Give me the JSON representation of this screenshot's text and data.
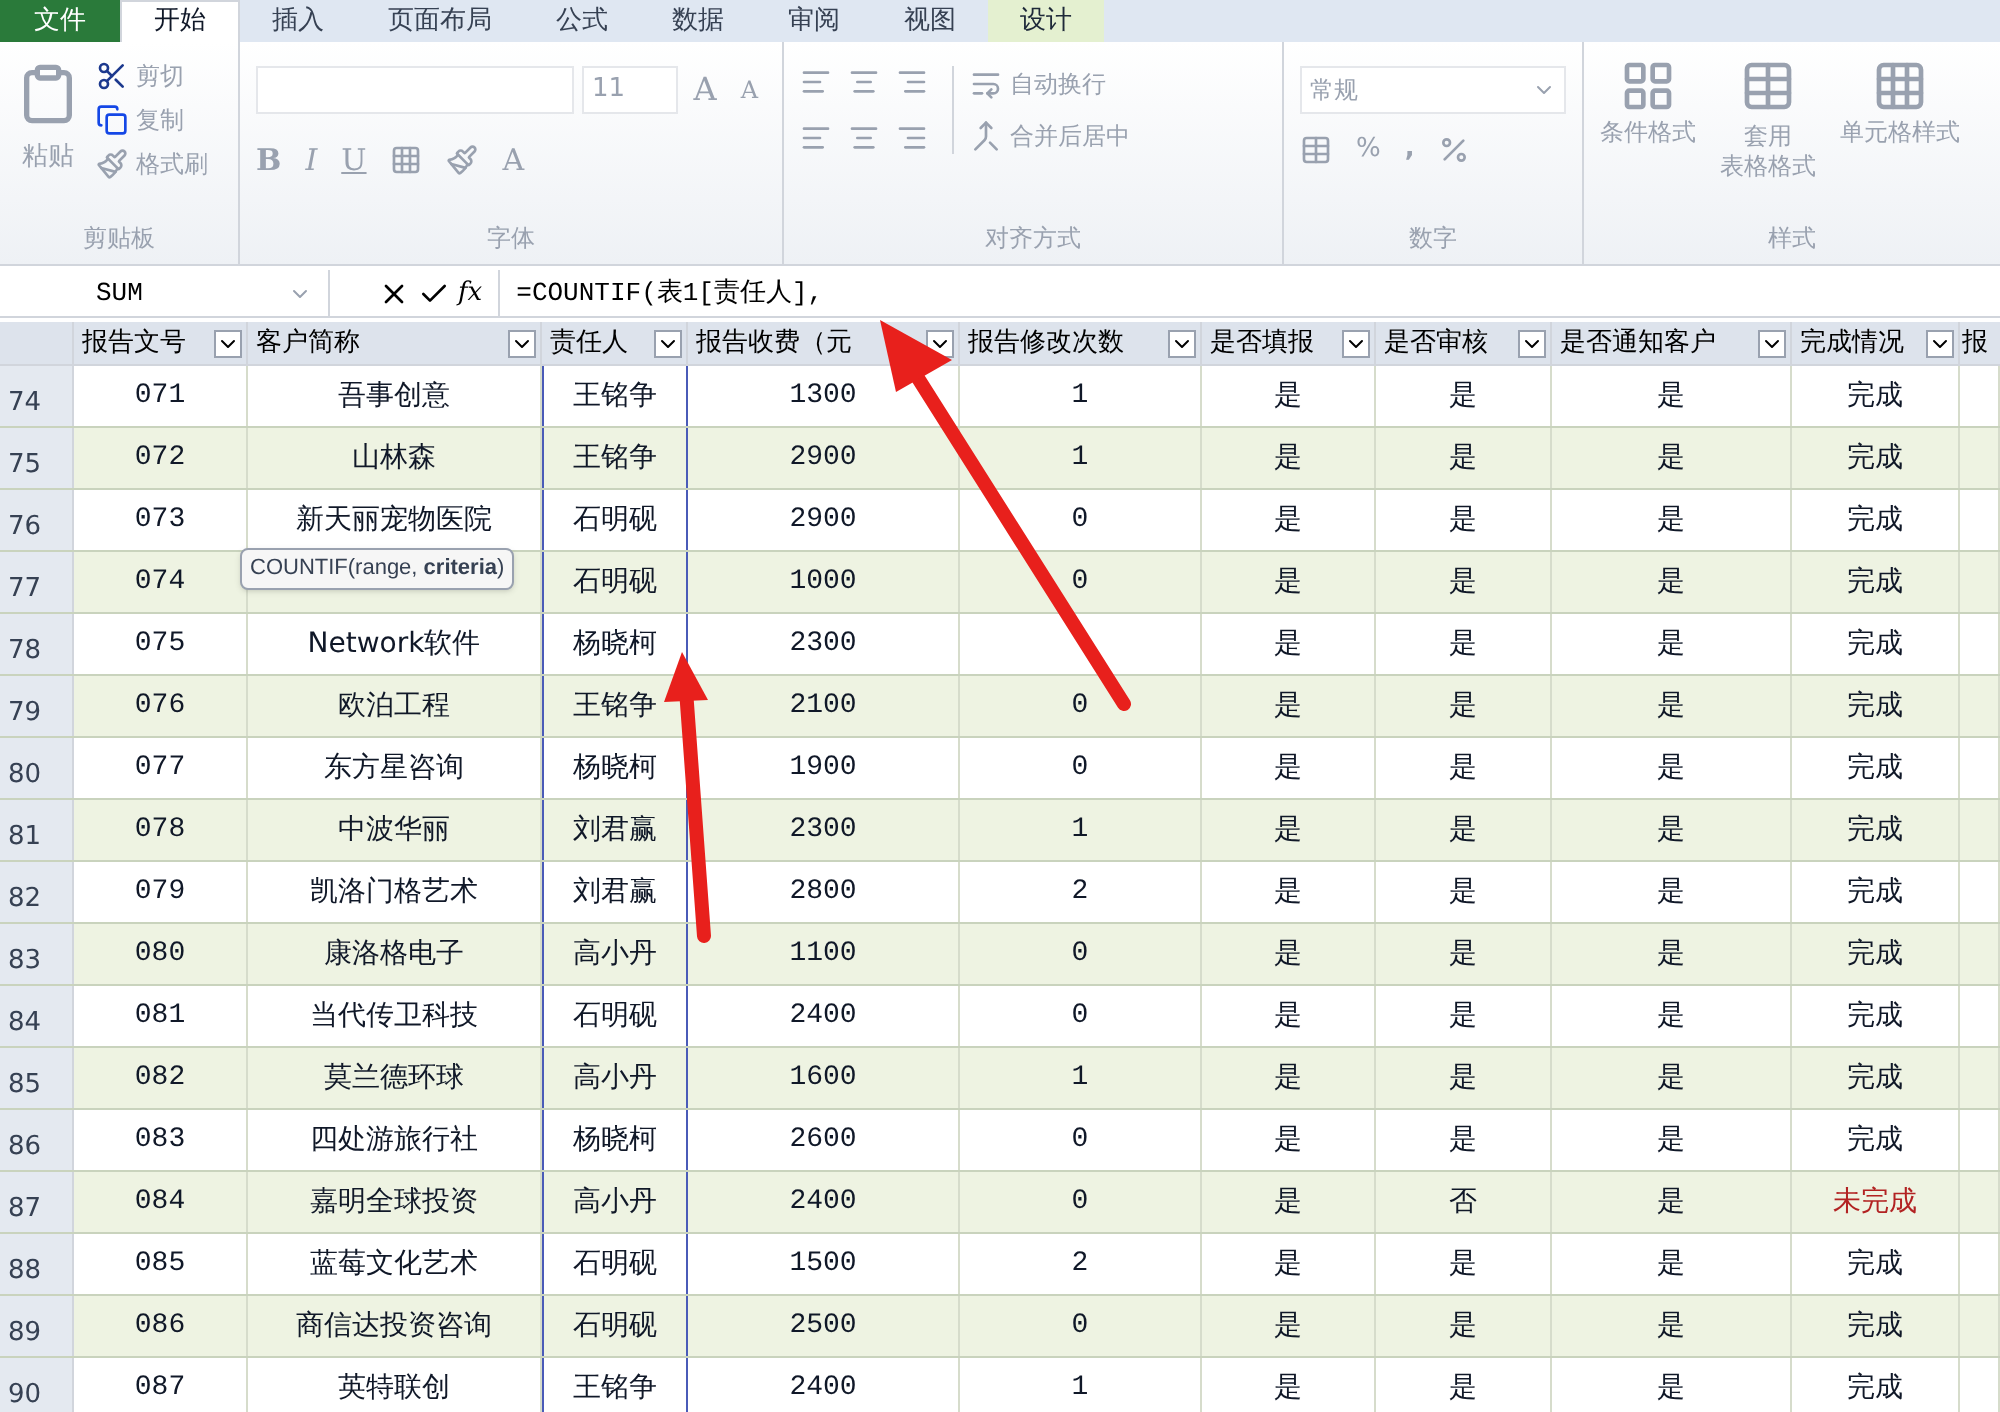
{
  "tabs": [
    {
      "label": "文件",
      "kind": "file",
      "selected": false
    },
    {
      "label": "开始",
      "kind": "normal",
      "selected": true
    },
    {
      "label": "插入",
      "kind": "normal",
      "selected": false
    },
    {
      "label": "页面布局",
      "kind": "normal",
      "selected": false
    },
    {
      "label": "公式",
      "kind": "normal",
      "selected": false
    },
    {
      "label": "数据",
      "kind": "normal",
      "selected": false
    },
    {
      "label": "审阅",
      "kind": "normal",
      "selected": false
    },
    {
      "label": "视图",
      "kind": "normal",
      "selected": false
    },
    {
      "label": "设计",
      "kind": "contextual",
      "selected": false
    }
  ],
  "ribbon": {
    "disabled": true,
    "clipboard": {
      "title": "剪贴板",
      "paste": "粘贴",
      "cut": "剪切",
      "copy": "复制",
      "format_painter": "格式刷"
    },
    "font": {
      "title": "字体",
      "size": "11",
      "grow": "A",
      "shrink": "A",
      "bold": "B",
      "italic": "I",
      "underline": "U",
      "font_color": "A"
    },
    "alignment": {
      "title": "对齐方式",
      "wrap": "自动换行",
      "merge": "合并后居中"
    },
    "number": {
      "title": "数字",
      "format": "常规",
      "percent": "%",
      "comma": ","
    },
    "styles": {
      "title": "样式",
      "conditional": "条件格式",
      "table_line1": "套用",
      "table_line2": "表格格式",
      "cell_styles": "单元格样式"
    }
  },
  "formula_bar": {
    "name_box": "SUM",
    "fx": "fx",
    "formula": "=COUNTIF(表1[责任人],"
  },
  "table": {
    "columns": [
      "报告文号",
      "客户简称",
      "责任人",
      "报告收费（元",
      "报告修改次数",
      "是否填报",
      "是否审核",
      "是否通知客户",
      "完成情况",
      "报"
    ],
    "rows": [
      {
        "row": "74",
        "cells": [
          "071",
          "吾事创意",
          "王铭争",
          "1300",
          "1",
          "是",
          "是",
          "是",
          "完成"
        ],
        "complete": true
      },
      {
        "row": "75",
        "cells": [
          "072",
          "山林森",
          "王铭争",
          "2900",
          "1",
          "是",
          "是",
          "是",
          "完成"
        ],
        "complete": true
      },
      {
        "row": "76",
        "cells": [
          "073",
          "新天丽宠物医院",
          "石明砚",
          "2900",
          "0",
          "是",
          "是",
          "是",
          "完成"
        ],
        "complete": true
      },
      {
        "row": "77",
        "cells": [
          "074",
          "",
          "石明砚",
          "1000",
          "0",
          "是",
          "是",
          "是",
          "完成"
        ],
        "complete": true,
        "tooltip": "COUNTIF(range, **criteria**)"
      },
      {
        "row": "78",
        "cells": [
          "075",
          "Network软件",
          "杨晓柯",
          "2300",
          "",
          "是",
          "是",
          "是",
          "完成"
        ],
        "complete": true
      },
      {
        "row": "79",
        "cells": [
          "076",
          "欧泊工程",
          "王铭争",
          "2100",
          "0",
          "是",
          "是",
          "是",
          "完成"
        ],
        "complete": true
      },
      {
        "row": "80",
        "cells": [
          "077",
          "东方星咨询",
          "杨晓柯",
          "1900",
          "0",
          "是",
          "是",
          "是",
          "完成"
        ],
        "complete": true
      },
      {
        "row": "81",
        "cells": [
          "078",
          "中波华丽",
          "刘君赢",
          "2300",
          "1",
          "是",
          "是",
          "是",
          "完成"
        ],
        "complete": true
      },
      {
        "row": "82",
        "cells": [
          "079",
          "凯洛门格艺术",
          "刘君赢",
          "2800",
          "2",
          "是",
          "是",
          "是",
          "完成"
        ],
        "complete": true
      },
      {
        "row": "83",
        "cells": [
          "080",
          "康洛格电子",
          "高小丹",
          "1100",
          "0",
          "是",
          "是",
          "是",
          "完成"
        ],
        "complete": true
      },
      {
        "row": "84",
        "cells": [
          "081",
          "当代传卫科技",
          "石明砚",
          "2400",
          "0",
          "是",
          "是",
          "是",
          "完成"
        ],
        "complete": true
      },
      {
        "row": "85",
        "cells": [
          "082",
          "莫兰德环球",
          "高小丹",
          "1600",
          "1",
          "是",
          "是",
          "是",
          "完成"
        ],
        "complete": true
      },
      {
        "row": "86",
        "cells": [
          "083",
          "四处游旅行社",
          "杨晓柯",
          "2600",
          "0",
          "是",
          "是",
          "是",
          "完成"
        ],
        "complete": true
      },
      {
        "row": "87",
        "cells": [
          "084",
          "嘉明全球投资",
          "高小丹",
          "2400",
          "0",
          "是",
          "否",
          "是",
          "未完成"
        ],
        "complete": false
      },
      {
        "row": "88",
        "cells": [
          "085",
          "蓝莓文化艺术",
          "石明砚",
          "1500",
          "2",
          "是",
          "是",
          "是",
          "完成"
        ],
        "complete": true
      },
      {
        "row": "89",
        "cells": [
          "086",
          "商信达投资咨询",
          "石明砚",
          "2500",
          "0",
          "是",
          "是",
          "是",
          "完成"
        ],
        "complete": true
      },
      {
        "row": "90",
        "cells": [
          "087",
          "英特联创",
          "王铭争",
          "2400",
          "1",
          "是",
          "是",
          "是",
          "完成"
        ],
        "complete": true
      }
    ]
  }
}
